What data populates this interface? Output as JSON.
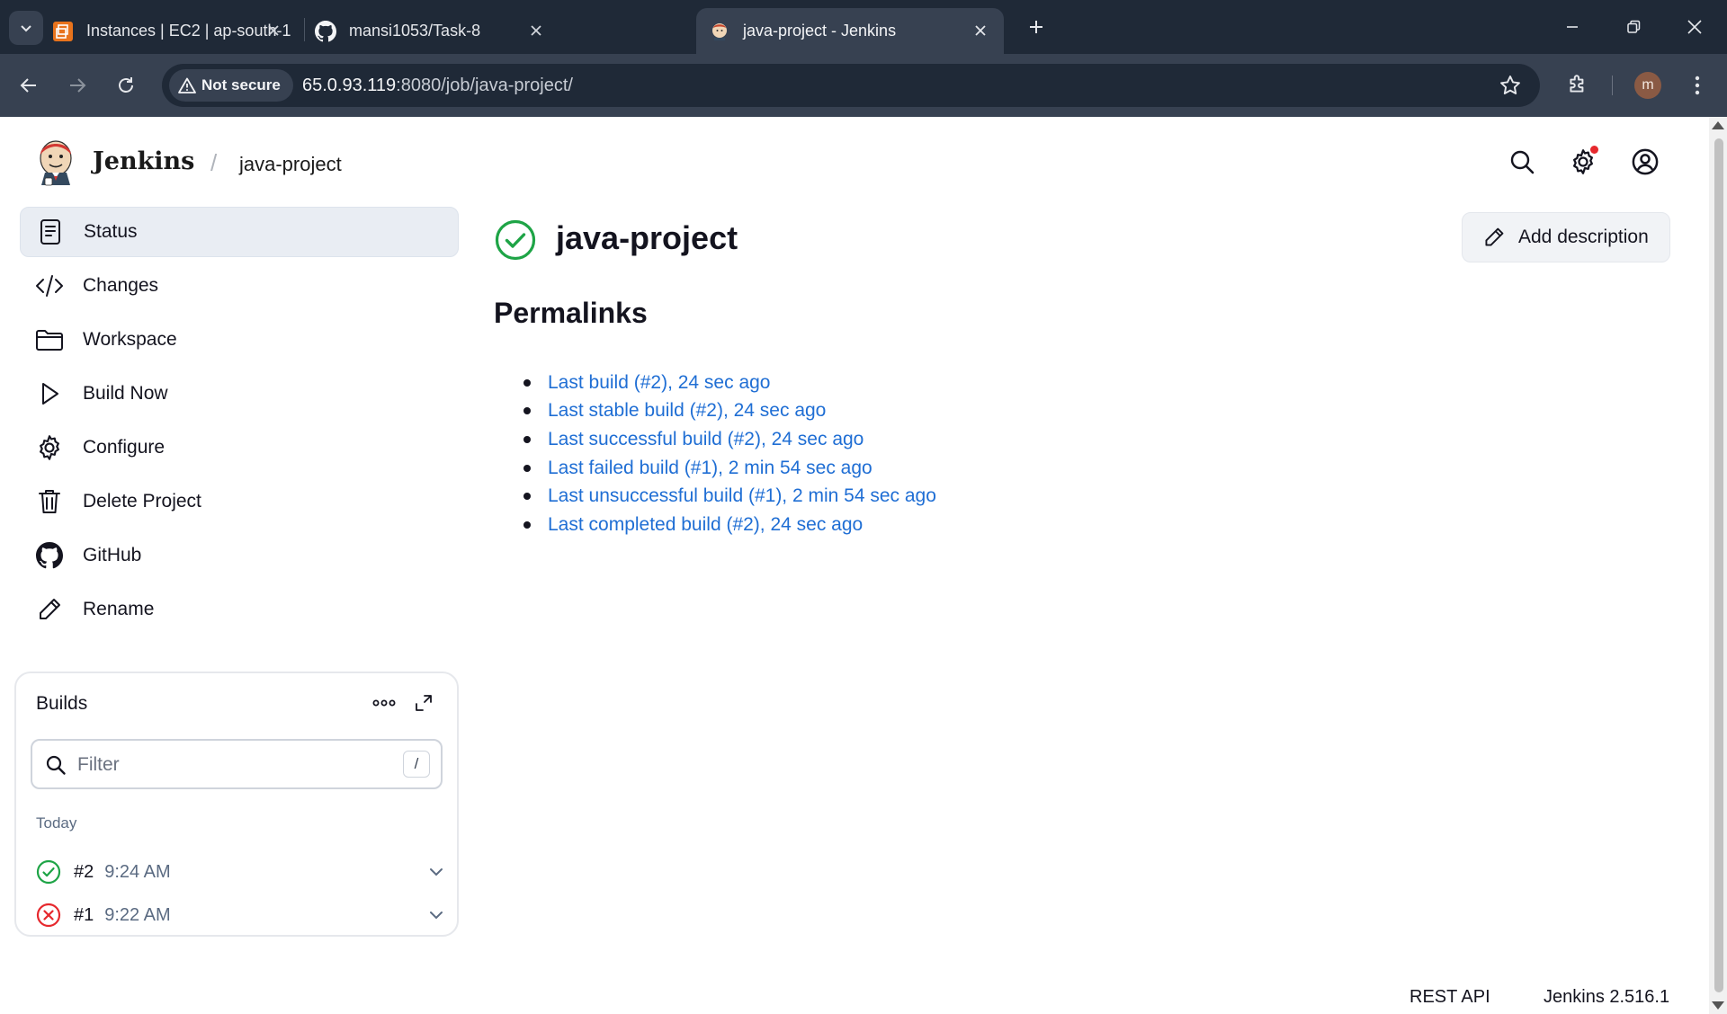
{
  "browser": {
    "tabs": [
      {
        "title": "Instances | EC2 | ap-south-1",
        "icon": "aws-ec2-icon",
        "active": false
      },
      {
        "title": "mansi1053/Task-8",
        "icon": "github-icon",
        "active": false
      },
      {
        "title": "java-project - Jenkins",
        "icon": "jenkins-icon",
        "active": true
      }
    ],
    "security_label": "Not secure",
    "url_host": "65.0.93.119",
    "url_rest": ":8080/job/java-project/",
    "profile_initial": "m"
  },
  "header": {
    "brand": "Jenkins",
    "breadcrumb_separator": "/",
    "breadcrumb": "java-project"
  },
  "sidebar": {
    "items": [
      {
        "label": "Status",
        "icon": "status-icon"
      },
      {
        "label": "Changes",
        "icon": "code-icon"
      },
      {
        "label": "Workspace",
        "icon": "folder-icon"
      },
      {
        "label": "Build Now",
        "icon": "play-icon"
      },
      {
        "label": "Configure",
        "icon": "gear-icon"
      },
      {
        "label": "Delete Project",
        "icon": "trash-icon"
      },
      {
        "label": "GitHub",
        "icon": "github-icon"
      },
      {
        "label": "Rename",
        "icon": "pencil-icon"
      }
    ]
  },
  "builds": {
    "title": "Builds",
    "filter_placeholder": "Filter",
    "filter_shortcut": "/",
    "group_label": "Today",
    "rows": [
      {
        "number": "#2",
        "time": "9:24 AM",
        "status": "success"
      },
      {
        "number": "#1",
        "time": "9:22 AM",
        "status": "failed"
      }
    ]
  },
  "main": {
    "job_title": "java-project",
    "add_description_label": "Add description",
    "permalinks_title": "Permalinks",
    "permalinks": [
      "Last build (#2), 24 sec ago",
      "Last stable build (#2), 24 sec ago",
      "Last successful build (#2), 24 sec ago",
      "Last failed build (#1), 2 min 54 sec ago",
      "Last unsuccessful build (#1), 2 min 54 sec ago",
      "Last completed build (#2), 24 sec ago"
    ]
  },
  "footer": {
    "rest_api": "REST API",
    "version": "Jenkins 2.516.1"
  },
  "colors": {
    "success": "#1ea446",
    "failed": "#e6282d",
    "link": "#1f6ed4",
    "chrome_dark": "#1f2937",
    "chrome_toolbar": "#374151"
  }
}
